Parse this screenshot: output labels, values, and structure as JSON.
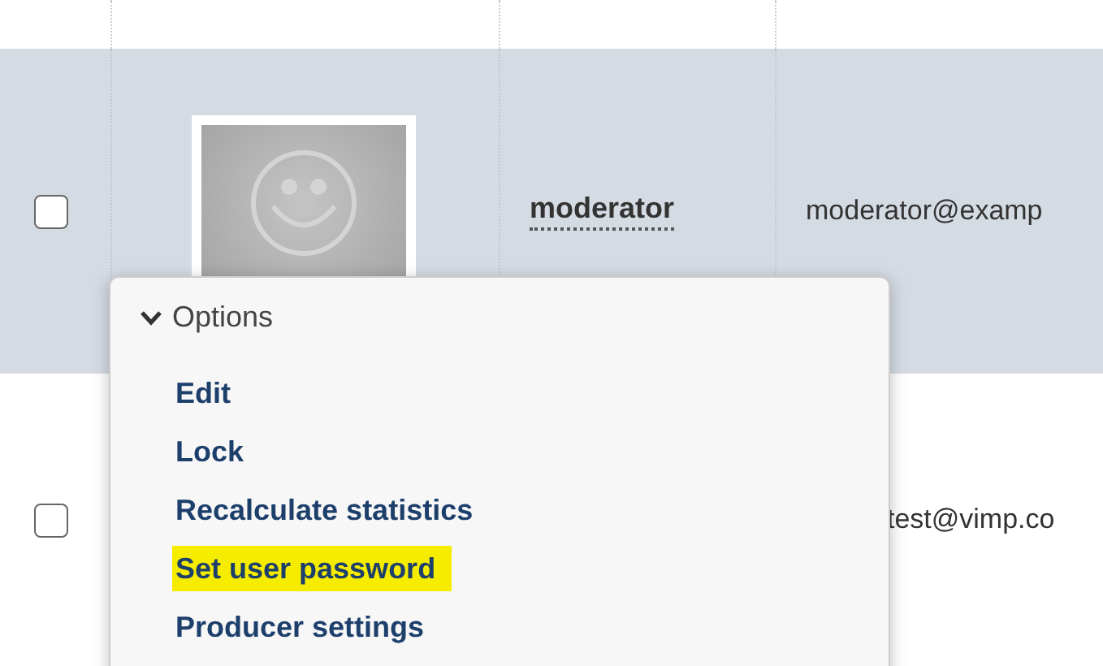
{
  "users": [
    {
      "selected": true,
      "checked": false,
      "username": "moderator",
      "email": "moderator@examp",
      "avatar": true
    },
    {
      "selected": false,
      "checked": false,
      "email": "test@vimp.co",
      "avatar": false
    }
  ],
  "options_menu": {
    "title": "Options",
    "expanded": true,
    "items": [
      {
        "label": "Edit",
        "highlighted": false
      },
      {
        "label": "Lock",
        "highlighted": false
      },
      {
        "label": "Recalculate statistics",
        "highlighted": false
      },
      {
        "label": "Set user password",
        "highlighted": true
      },
      {
        "label": "Producer settings",
        "highlighted": false
      }
    ]
  }
}
